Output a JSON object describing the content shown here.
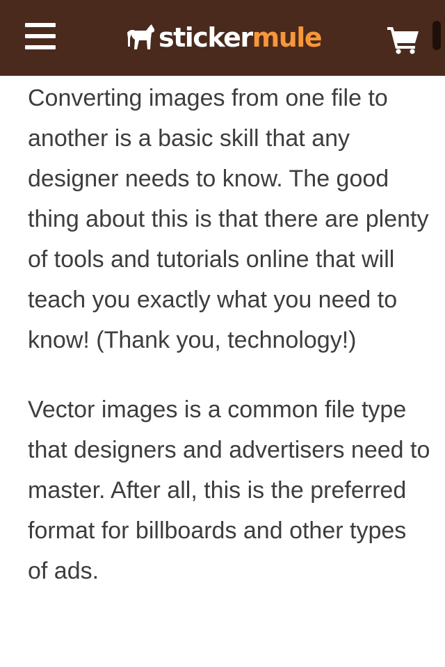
{
  "header": {
    "brand": {
      "part1": "sticker",
      "part2": "mule"
    },
    "menu_icon": "hamburger-menu-icon",
    "cart_icon": "shopping-cart-icon",
    "colors": {
      "bar": "#4a2a1d",
      "accent": "#f7973a",
      "text": "#ffffff"
    }
  },
  "article": {
    "paragraphs": [
      "Converting images from one file to another is a basic skill that any designer needs to know. The good thing about this is that there are plenty of tools and tutorials online that will teach you exactly what you need to know! (Thank you, technology!)",
      "Vector images is a common file type that designers and advertisers need to master. After all, this is the preferred format for billboards and other types of ads."
    ],
    "text_color": "#3d3d3d"
  }
}
